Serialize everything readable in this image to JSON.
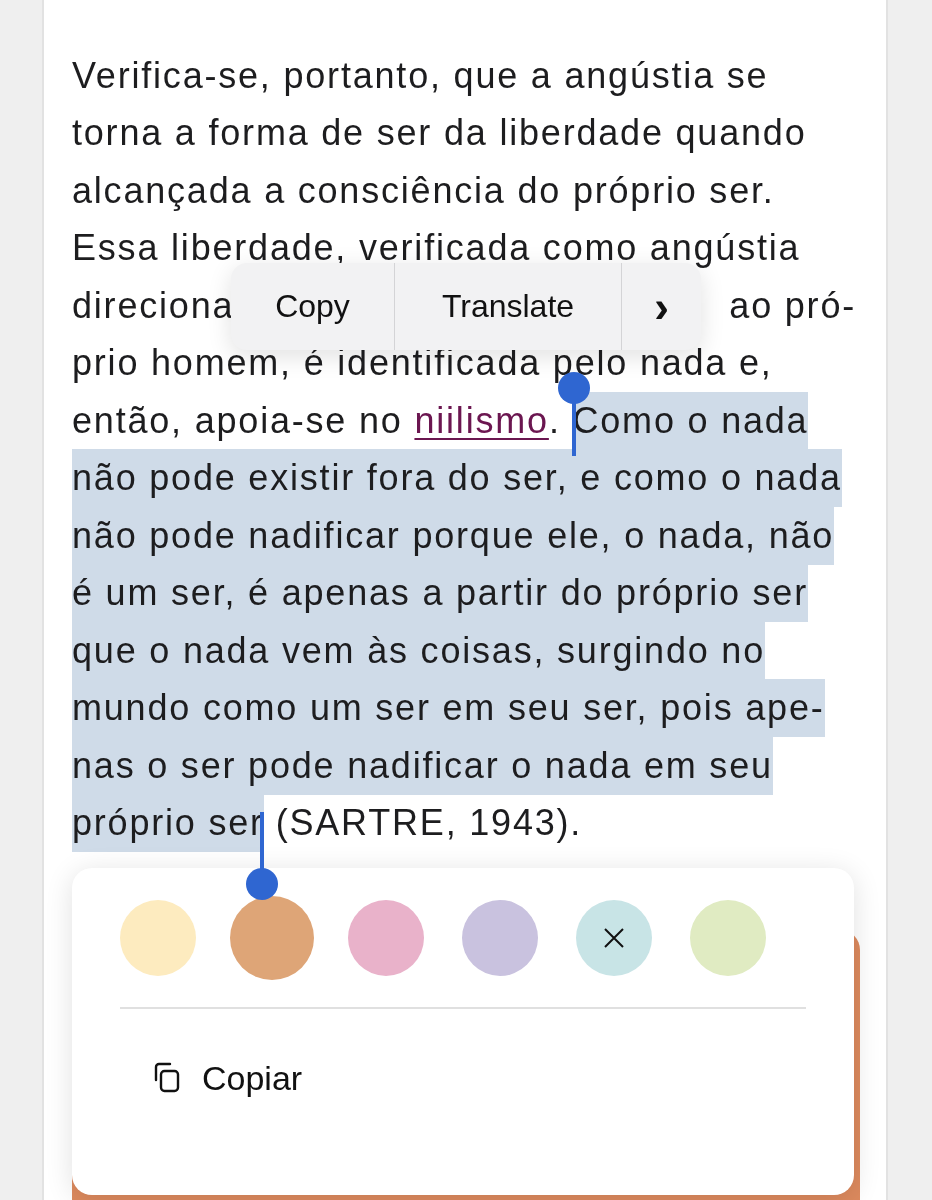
{
  "paragraph": {
    "lines": [
      [
        {
          "text": "Verifica-se, portanto, que a angústia se",
          "kind": "text",
          "selected": false
        }
      ],
      [
        {
          "text": "torna a forma de ser da liberdade quando",
          "kind": "text",
          "selected": false
        }
      ],
      [
        {
          "text": "alcançada a consciência do próprio ser.",
          "kind": "text",
          "selected": false
        }
      ],
      [
        {
          "text": "Essa liberdade, verificada como angústia",
          "kind": "text",
          "selected": false
        }
      ],
      [
        {
          "text": "direciona",
          "kind": "text",
          "selected": false
        },
        {
          "text": "ao pró-",
          "kind": "after_gap",
          "selected": false
        }
      ],
      [
        {
          "text": "prio homem, é identificada pelo nada e,",
          "kind": "text",
          "selected": false
        }
      ],
      [
        {
          "text": "então, apoia-se no ",
          "kind": "text",
          "selected": false
        },
        {
          "text": "niilismo",
          "kind": "link",
          "selected": false
        },
        {
          "text": ". ",
          "kind": "text",
          "selected": false
        },
        {
          "text": "Como o nada",
          "kind": "text",
          "selected": true
        }
      ],
      [
        {
          "text": "não pode existir fora do ser, e como o nada",
          "kind": "text",
          "selected": true
        }
      ],
      [
        {
          "text": "não pode nadificar porque ele, o nada, não",
          "kind": "text",
          "selected": true
        }
      ],
      [
        {
          "text": "é um ser, é apenas a partir do próprio ser",
          "kind": "text",
          "selected": true
        }
      ],
      [
        {
          "text": "que o nada vem às coisas, surgindo no",
          "kind": "text",
          "selected": true
        }
      ],
      [
        {
          "text": "mundo como um ser em seu ser, pois ape-",
          "kind": "text",
          "selected": true
        }
      ],
      [
        {
          "text": "nas o ser pode nadificar o nada em seu",
          "kind": "text",
          "selected": true
        }
      ],
      [
        {
          "text": "próprio ser",
          "kind": "text",
          "selected": true
        },
        {
          "text": " (SARTRE, 1943).",
          "kind": "text",
          "selected": false
        }
      ]
    ]
  },
  "edit_menu": {
    "items": [
      {
        "label": "Copy",
        "kind": "text"
      },
      {
        "label": "Translate",
        "kind": "text"
      },
      {
        "label": "›",
        "kind": "more"
      }
    ]
  },
  "highlight_popup": {
    "colors": [
      {
        "color": "#fdebbf",
        "selected": false,
        "kind": "swatch"
      },
      {
        "color": "#dea577",
        "selected": true,
        "kind": "swatch"
      },
      {
        "color": "#e9b2ca",
        "selected": false,
        "kind": "swatch"
      },
      {
        "color": "#c9c2df",
        "selected": false,
        "kind": "swatch"
      },
      {
        "color": "#c8e4e6",
        "selected": false,
        "kind": "remove"
      },
      {
        "color": "#e0ebc2",
        "selected": false,
        "kind": "swatch"
      }
    ],
    "action": {
      "label": "Copiar"
    }
  }
}
